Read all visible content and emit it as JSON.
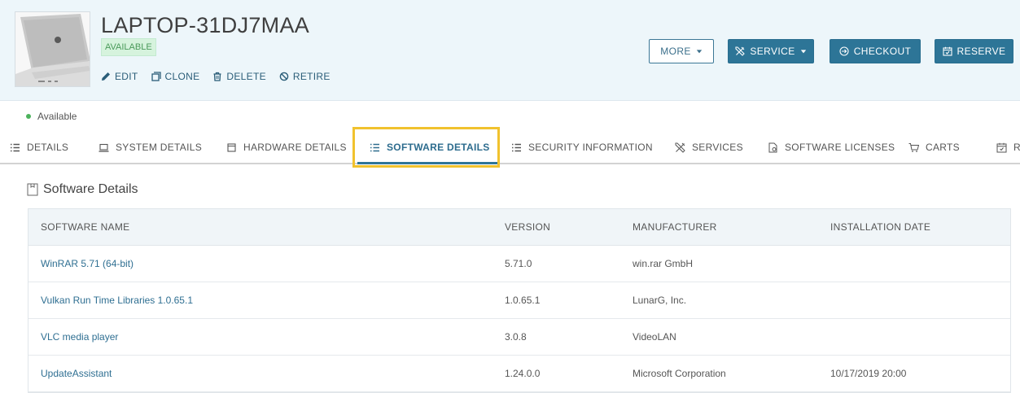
{
  "asset": {
    "name": "LAPTOP-31DJ7MAA",
    "badge": "AVAILABLE",
    "status": "Available"
  },
  "actions": {
    "edit": "EDIT",
    "clone": "CLONE",
    "delete": "DELETE",
    "retire": "RETIRE"
  },
  "buttons": {
    "more": "MORE",
    "service": "SERVICE",
    "checkout": "CHECKOUT",
    "reserve": "RESERVE"
  },
  "tabs": [
    {
      "label": "DETAILS"
    },
    {
      "label": "SYSTEM DETAILS"
    },
    {
      "label": "HARDWARE DETAILS"
    },
    {
      "label": "SOFTWARE DETAILS"
    },
    {
      "label": "SECURITY INFORMATION"
    },
    {
      "label": "SERVICES"
    },
    {
      "label": "SOFTWARE LICENSES"
    },
    {
      "label": "CARTS"
    },
    {
      "label": "R"
    }
  ],
  "section": {
    "title": "Software Details"
  },
  "table": {
    "headers": [
      "SOFTWARE NAME",
      "VERSION",
      "MANUFACTURER",
      "INSTALLATION DATE"
    ],
    "rows": [
      {
        "name": "WinRAR 5.71 (64-bit)",
        "version": "5.71.0",
        "manufacturer": "win.rar GmbH",
        "date": ""
      },
      {
        "name": "Vulkan Run Time Libraries 1.0.65.1",
        "version": "1.0.65.1",
        "manufacturer": "LunarG, Inc.",
        "date": ""
      },
      {
        "name": "VLC media player",
        "version": "3.0.8",
        "manufacturer": "VideoLAN",
        "date": ""
      },
      {
        "name": "UpdateAssistant",
        "version": "1.24.0.0",
        "manufacturer": "Microsoft Corporation",
        "date": "10/17/2019 20:00"
      }
    ]
  },
  "colors": {
    "accent": "#2d7597",
    "highlight": "#f1c22e",
    "status_green": "#4cb25c"
  }
}
